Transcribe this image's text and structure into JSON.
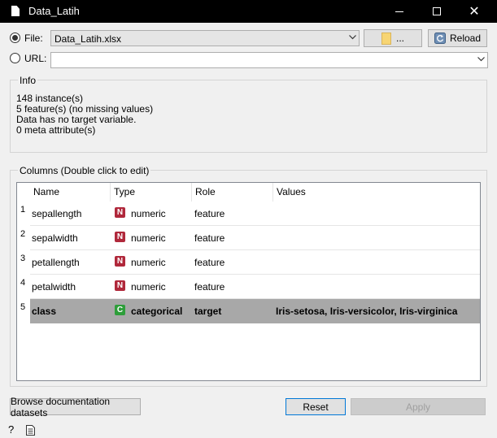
{
  "window": {
    "title": "Data_Latih"
  },
  "source": {
    "file_label": "File:",
    "file_value": "Data_Latih.xlsx",
    "browse_label": "...",
    "reload_label": "Reload",
    "url_label": "URL:",
    "url_value": ""
  },
  "info": {
    "title": "Info",
    "lines": [
      "148 instance(s)",
      "5 feature(s) (no missing values)",
      "Data has no target variable.",
      "0 meta attribute(s)"
    ]
  },
  "columns": {
    "title": "Columns (Double click to edit)",
    "headers": [
      "Name",
      "Type",
      "Role",
      "Values"
    ],
    "rows": [
      {
        "num": "1",
        "name": "sepallength",
        "type_badge": "N",
        "type": "numeric",
        "role": "feature",
        "values": ""
      },
      {
        "num": "2",
        "name": "sepalwidth",
        "type_badge": "N",
        "type": "numeric",
        "role": "feature",
        "values": ""
      },
      {
        "num": "3",
        "name": "petallength",
        "type_badge": "N",
        "type": "numeric",
        "role": "feature",
        "values": ""
      },
      {
        "num": "4",
        "name": "petalwidth",
        "type_badge": "N",
        "type": "numeric",
        "role": "feature",
        "values": ""
      },
      {
        "num": "5",
        "name": "class",
        "type_badge": "C",
        "type": "categorical",
        "role": "target",
        "values": "Iris-setosa, Iris-versicolor, Iris-virginica"
      }
    ]
  },
  "footer": {
    "browse_docs_label": "Browse documentation datasets",
    "reset_label": "Reset",
    "apply_label": "Apply"
  },
  "status": {
    "help_icon": "?",
    "report_icon": "report-icon"
  },
  "colors": {
    "numeric_badge": "#b0283b",
    "categorical_badge": "#2e9e3a",
    "selected_row": "#a8a8a8"
  }
}
